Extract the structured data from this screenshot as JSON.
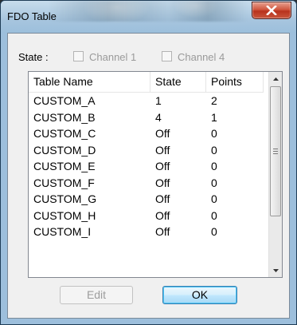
{
  "window": {
    "title": "FDO Table"
  },
  "state": {
    "label": "State :",
    "channels": [
      {
        "label": "Channel 1",
        "checked": false,
        "enabled": false
      },
      {
        "label": "Channel 4",
        "checked": false,
        "enabled": false
      }
    ]
  },
  "table": {
    "columns": [
      "Table Name",
      "State",
      "Points"
    ],
    "rows": [
      [
        "CUSTOM_A",
        "1",
        "2"
      ],
      [
        "CUSTOM_B",
        "4",
        "1"
      ],
      [
        "CUSTOM_C",
        "Off",
        "0"
      ],
      [
        "CUSTOM_D",
        "Off",
        "0"
      ],
      [
        "CUSTOM_E",
        "Off",
        "0"
      ],
      [
        "CUSTOM_F",
        "Off",
        "0"
      ],
      [
        "CUSTOM_G",
        "Off",
        "0"
      ],
      [
        "CUSTOM_H",
        "Off",
        "0"
      ],
      [
        "CUSTOM_I",
        "Off",
        "0"
      ]
    ]
  },
  "buttons": {
    "edit": "Edit",
    "ok": "OK"
  },
  "icons": {
    "close": "close-icon",
    "scroll_up": "scroll-up-arrow-icon",
    "scroll_down": "scroll-down-arrow-icon"
  },
  "colors": {
    "titlebar": "#9dbfdc",
    "close_button": "#c9563c",
    "ok_button_border": "#3c7fb1"
  }
}
